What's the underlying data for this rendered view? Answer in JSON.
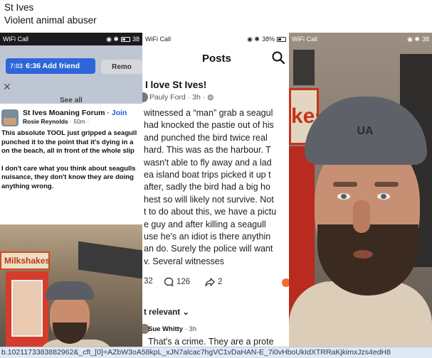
{
  "caption": {
    "line1": "St Ives",
    "line2": "Violent animal abuser"
  },
  "left_panel": {
    "status_left": "WiFi Call",
    "status_right": "38",
    "overlay": {
      "time": "7:03",
      "add_friend": "6:36 Add friend",
      "remove": "Remo",
      "see_all": "See all"
    },
    "post": {
      "group": "St Ives Moaning Forum",
      "join": "· Join",
      "author": "Rosie Reynolds",
      "age": "· 50m ·",
      "para1": [
        "This absolute TOOL just gripped a seagull",
        "punched it to the point that it's dying in a",
        "on the beach, all in front of the whole slip"
      ],
      "para2": [
        "I don't care what you think about seagulls",
        "nuisance, they don't know they are doing",
        "anything wrong."
      ]
    },
    "shop_sign": "Milkshakes"
  },
  "middle_panel": {
    "status_left": "WiFi Call",
    "status_right": "38%",
    "title": "Posts",
    "post_heading": "I love St Ives!",
    "author": "Pauly Ford",
    "age": "· 3h ·",
    "body_lines": [
      "witnessed a “man” grab a seagul",
      "had knocked the pastie out of his",
      "and punched the bird twice real",
      "hard. This was as the harbour. T",
      "wasn't able to fly away and a lad",
      "ea island boat trips picked it up t",
      "after, sadly the bird had a big ho",
      "hest so will likely not survive. Not",
      "t to do about this, we have a pictu",
      "e guy and after killing a seagull",
      "use he's an idiot is there anythin",
      "an do. Surely the police will want",
      "v. Several witnesses"
    ],
    "reactions_count": "32",
    "comments_count": "126",
    "shares_count": "2",
    "sort_label": "t relevant",
    "comment_author": "Sue Whitty",
    "comment_age": "· 3h",
    "comment_body": "That's a crime. They are a prote"
  },
  "right_panel": {
    "status_left": "WiFi Call",
    "status_right": "38",
    "sign_text": "kes",
    "cap_logo": "UA"
  },
  "url_bar": {
    "text": "b.1021173383882962&_cft_[0]=AZbW3oA58kpL_xJN7alcac7hgVC1vDaHAN-E_7i0vHboUkIdXTRRaKjkimxJzs4edH8"
  },
  "colors": {
    "facebook_blue": "#2e66d9",
    "join_link": "#1a5ad8",
    "shop_red": "#b82b1e"
  }
}
